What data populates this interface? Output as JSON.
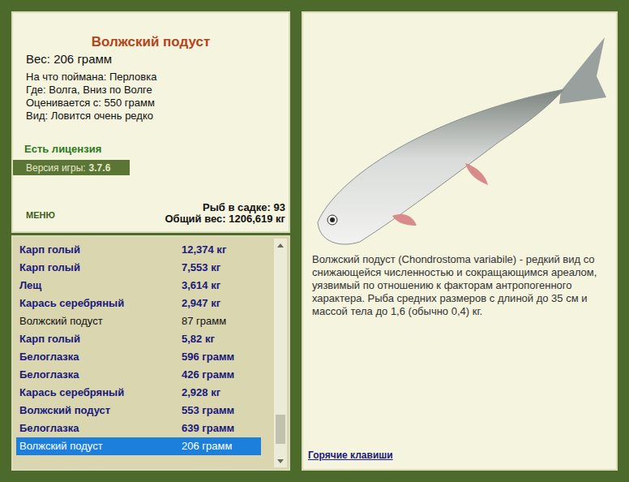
{
  "fish_card": {
    "title": "Волжский подуст",
    "weight": "Вес: 206 грамм",
    "info": [
      "На что поймана: Перловка",
      "Где: Волга, Вниз по Волге",
      "Оценивается с: 550 грамм",
      "Вид: Ловится очень редко"
    ],
    "license": "Есть лицензия",
    "version_label": "Версия игры:",
    "version": "3.7.6"
  },
  "menu": "МЕНЮ",
  "keepnet": {
    "count": "Рыб в садке: 93",
    "total": "Общий вес: 1206,619 кг"
  },
  "catch_list": {
    "rows": [
      {
        "name": "Карп голый",
        "weight": "12,374 кг",
        "bold": true,
        "selected": false
      },
      {
        "name": "Карп голый",
        "weight": "7,553 кг",
        "bold": true,
        "selected": false
      },
      {
        "name": "Лещ",
        "weight": "3,614 кг",
        "bold": true,
        "selected": false
      },
      {
        "name": "Карась серебряный",
        "weight": "2,947 кг",
        "bold": true,
        "selected": false
      },
      {
        "name": "Волжский подуст",
        "weight": "87 грамм",
        "bold": false,
        "selected": false
      },
      {
        "name": "Карп голый",
        "weight": "5,82 кг",
        "bold": true,
        "selected": false
      },
      {
        "name": "Белоглазка",
        "weight": "596 грамм",
        "bold": true,
        "selected": false
      },
      {
        "name": "Белоглазка",
        "weight": "426 грамм",
        "bold": true,
        "selected": false
      },
      {
        "name": "Карась серебряный",
        "weight": "2,928 кг",
        "bold": true,
        "selected": false
      },
      {
        "name": "Волжский подуст",
        "weight": "553 грамм",
        "bold": true,
        "selected": false
      },
      {
        "name": "Белоглазка",
        "weight": "639 грамм",
        "bold": true,
        "selected": false
      },
      {
        "name": "Волжский подуст",
        "weight": "206 грамм",
        "bold": false,
        "selected": true
      }
    ],
    "scrollbar": {
      "level": 0.92
    }
  },
  "description": "Волжский подуст (Chondrostoma variabile) - редкий вид со снижающейся численностью и сокращающимся ареалом, уязвимый по отношению к факторам антропогенного характера. Рыба средних размеров с длиной до 35 см и массой тела до 1,6 (обычно 0,4) кг.",
  "hotkeys_link": "Горячие клавиши"
}
